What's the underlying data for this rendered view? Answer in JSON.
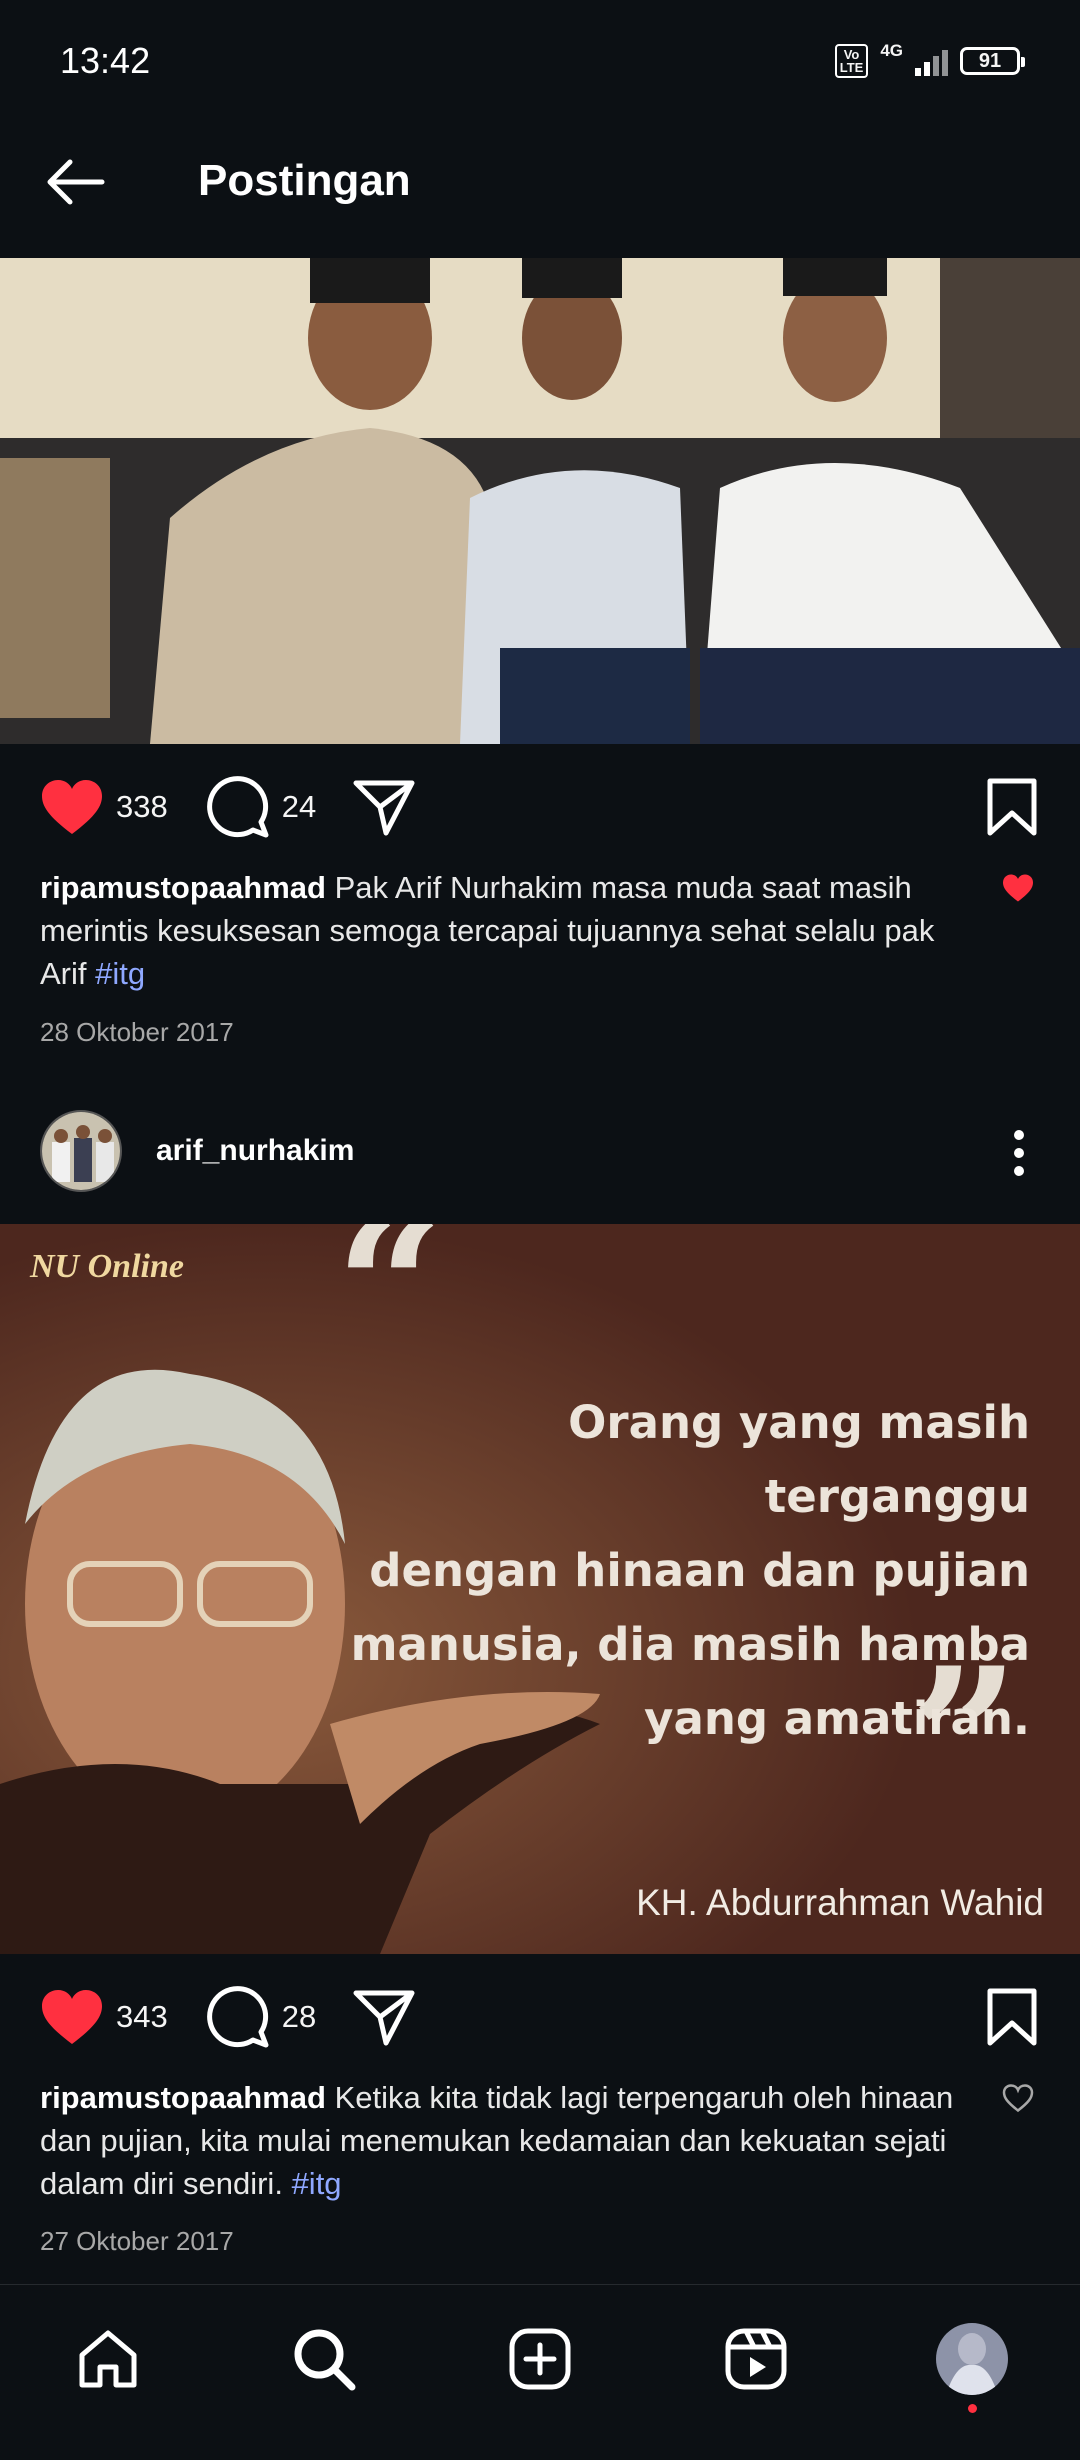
{
  "status_bar": {
    "time": "13:42",
    "volte_top": "Vo",
    "volte_bottom": "LTE",
    "network": "4G",
    "battery": "91"
  },
  "header": {
    "title": "Postingan"
  },
  "posts": [
    {
      "likes": "338",
      "comments": "24",
      "caption_user": "ripamustopaahmad",
      "caption_text": "Pak Arif Nurhakim masa muda saat masih merintis kesuksesan semoga tercapai tujuannya sehat selalu pak Arif",
      "hashtag": "#itg",
      "date": "28 Oktober 2017",
      "liked_caption": true
    },
    {
      "author": "arif_nurhakim",
      "image_logo": "NU Online",
      "image_quote": [
        "Orang yang masih terganggu",
        "dengan hinaan dan pujian",
        "manusia, dia masih hamba",
        "yang amatiran."
      ],
      "image_attribution": "KH. Abdurrahman Wahid",
      "likes": "343",
      "comments": "28",
      "caption_user": "ripamustopaahmad",
      "caption_text": "Ketika kita tidak lagi terpengaruh oleh hinaan dan pujian, kita mulai menemukan kedamaian dan kekuatan sejati dalam diri sendiri.",
      "hashtag": "#itg",
      "date": "27 Oktober 2017",
      "liked_caption": false
    }
  ],
  "colors": {
    "background": "#0c1014",
    "like": "#ff3040",
    "hashtag": "#8fa8ff",
    "quote_bg": "#5a2f24"
  },
  "icons": {
    "back": "arrow-left-icon",
    "like": "heart-icon",
    "comment": "comment-icon",
    "share": "send-icon",
    "save": "bookmark-icon",
    "more": "more-vertical-icon",
    "home": "home-icon",
    "search": "search-icon",
    "create": "add-square-icon",
    "reels": "reels-icon",
    "profile": "profile-avatar"
  }
}
